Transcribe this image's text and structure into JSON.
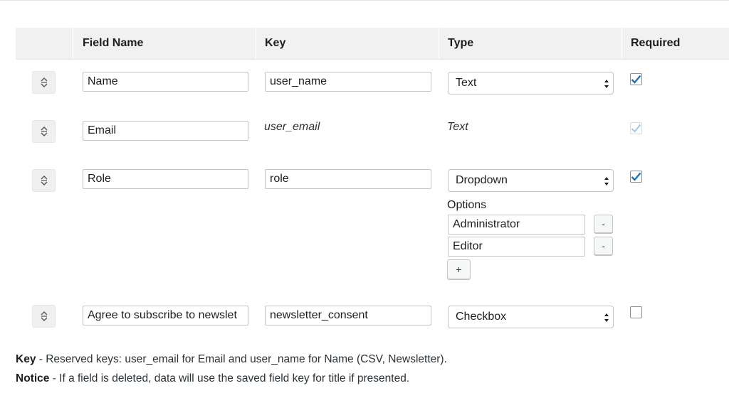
{
  "table": {
    "headers": {
      "field_name": "Field Name",
      "key": "Key",
      "type": "Type",
      "required": "Required"
    },
    "rows": [
      {
        "field_name": "Name",
        "key": "user_name",
        "type": "Text",
        "required": true
      },
      {
        "field_name": "Email",
        "key": "user_email",
        "type": "Text",
        "required": true,
        "locked": true
      },
      {
        "field_name": "Role",
        "key": "role",
        "type": "Dropdown",
        "required": true,
        "options_label": "Options",
        "options": [
          "Administrator",
          "Editor"
        ],
        "remove_label": "-",
        "add_label": "+"
      },
      {
        "field_name": "Agree to subscribe to newslet",
        "key": "newsletter_consent",
        "type": "Checkbox",
        "required": false
      }
    ]
  },
  "notes": {
    "key_label": "Key",
    "key_text": " - Reserved keys: user_email for Email and user_name for Name (CSV, Newsletter).",
    "notice_label": "Notice",
    "notice_text": " - If a field is deleted, data will use the saved field key for title if presented."
  },
  "colors": {
    "check_active": "#2271b1",
    "check_disabled": "#a7cbe6",
    "header_bg": "#f1f1f1"
  },
  "icons": {
    "drag_handle": "updown-arrows-icon",
    "select_arrow": "select-arrows-icon",
    "checkmark": "checkmark-icon"
  }
}
